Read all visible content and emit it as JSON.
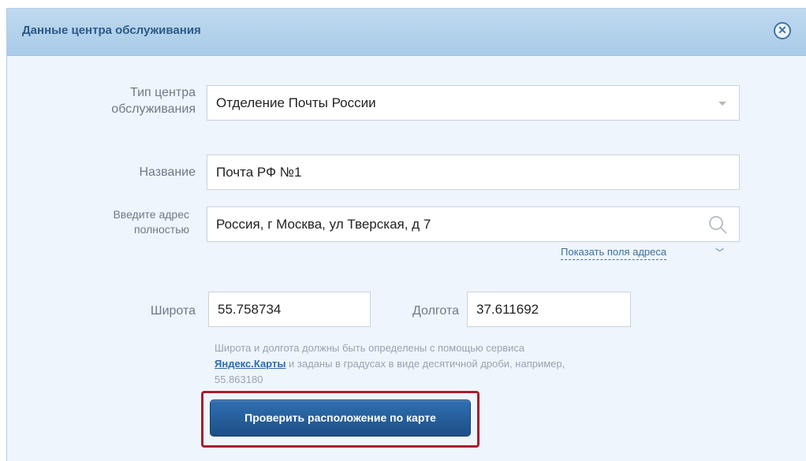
{
  "dialog": {
    "title": "Данные центра обслуживания",
    "close_icon": "close-circle-icon"
  },
  "form": {
    "type": {
      "label_line1": "Тип центра",
      "label_line2": "обслуживания",
      "value": "Отделение Почты России"
    },
    "name": {
      "label": "Название",
      "value": "Почта РФ №1"
    },
    "address": {
      "label_line1": "Введите адрес",
      "label_line2": "полностью",
      "value": "Россия, г Москва, ул Тверская, д 7",
      "search_icon": "search-icon",
      "show_fields_link": "Показать поля адреса"
    },
    "latitude": {
      "label": "Широта",
      "value": "55.758734"
    },
    "longitude": {
      "label": "Долгота",
      "value": "37.611692"
    },
    "hint": {
      "text_before": "Широта и долгота должны быть определены с помощью сервиса",
      "link": "Яндекс.Карты",
      "text_after": "и заданы в градусах в виде десятичной дроби, например,",
      "example": "55.863180"
    },
    "check_button": "Проверить расположение по карте"
  },
  "colors": {
    "header_bg": "#a9cbe8",
    "body_bg": "#eef5fc",
    "button_bg": "#1d4f88",
    "highlight": "#a81e2d",
    "link": "#2b6bb0"
  }
}
